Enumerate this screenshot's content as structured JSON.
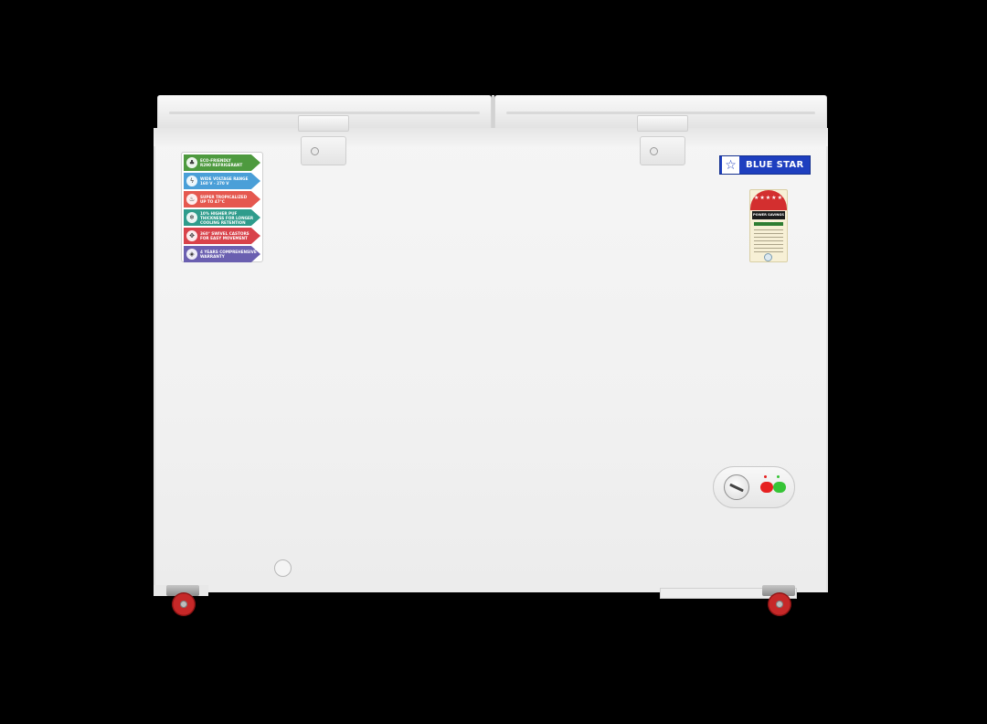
{
  "brand": {
    "name": "BLUE STAR",
    "color": "#1e3fbf",
    "logo_icon": "star-in-square-icon"
  },
  "energy_label": {
    "title": "POWER SAVINGS GUIDE",
    "stars": 5
  },
  "features": [
    {
      "text": "ECO-FRIENDLY\nR290 REFRIGERANT",
      "icon": "leaf-icon",
      "color": "#4e9a3f"
    },
    {
      "text": "WIDE VOLTAGE RANGE\n160 V - 270 V",
      "icon": "voltage-icon",
      "color": "#4a9fd8"
    },
    {
      "text": "SUPER TROPICALIZED\nUP TO 47°C",
      "icon": "thermometer-icon",
      "color": "#e5584f"
    },
    {
      "text": "10% HIGHER PUF\nTHICKNESS FOR LONGER\nCOOLING RETENTION",
      "icon": "snowflake-icon",
      "color": "#2f9c8c"
    },
    {
      "text": "360° SWIVEL CASTORS\nFOR EASY MOVEMENT",
      "icon": "castor-icon",
      "color": "#d8424a"
    },
    {
      "text": "4 YEARS COMPREHENSIVE\nWARRANTY",
      "icon": "shield-icon",
      "color": "#6a5fb0"
    }
  ],
  "controls": {
    "knob_icon": "thermostat-knob-icon",
    "indicator_colors": [
      "#e62020",
      "#36c436"
    ]
  }
}
